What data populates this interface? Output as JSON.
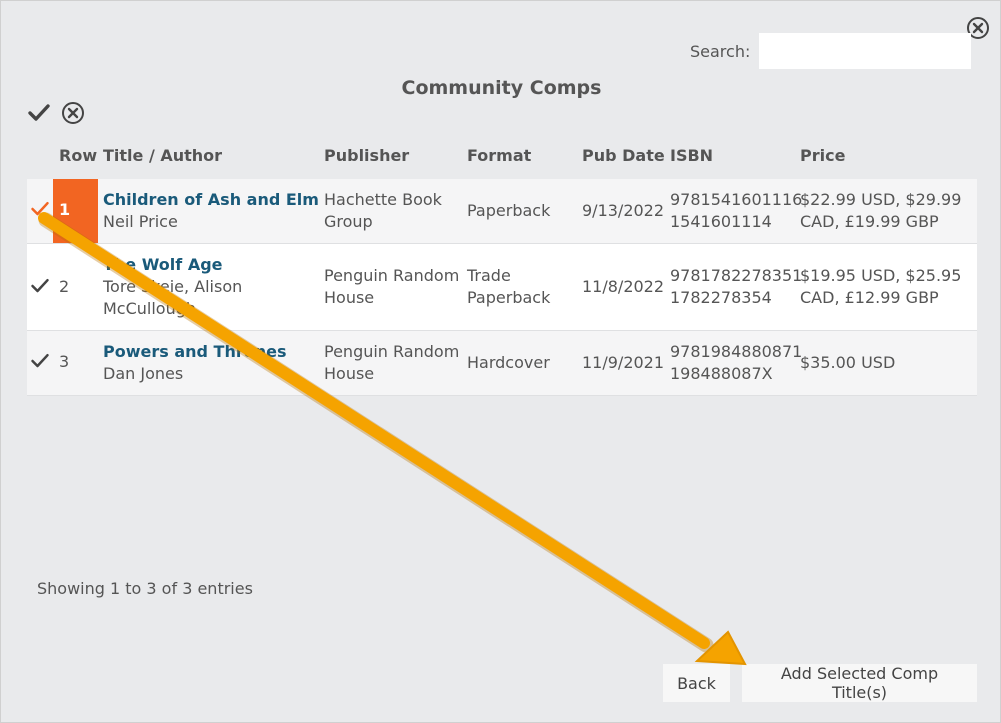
{
  "search": {
    "label": "Search:",
    "value": "",
    "placeholder": ""
  },
  "dialog": {
    "title": "Community Comps"
  },
  "columns": {
    "row": "Row",
    "title_author": "Title / Author",
    "publisher": "Publisher",
    "format": "Format",
    "pub_date": "Pub Date",
    "isbn": "ISBN",
    "price": "Price"
  },
  "rows": [
    {
      "num": "1",
      "title": "Children of Ash and Elm",
      "author": "Neil Price",
      "publisher_l1": "Hachette Book",
      "publisher_l2": "Group",
      "format_l1": "Paperback",
      "format_l2": "",
      "pub_date": "9/13/2022",
      "isbn13": "9781541601116",
      "isbn10": "1541601114",
      "price_l1": "$22.99 USD, $29.99",
      "price_l2": "CAD, £19.99 GBP",
      "selected": true
    },
    {
      "num": "2",
      "title": "The Wolf Age",
      "author_l1": "Tore Skeie, Alison",
      "author_l2": "McCullough",
      "publisher_l1": "Penguin Random",
      "publisher_l2": "House",
      "format_l1": "Trade",
      "format_l2": "Paperback",
      "pub_date": "11/8/2022",
      "isbn13": "9781782278351",
      "isbn10": "1782278354",
      "price_l1": "$19.95 USD, $25.95",
      "price_l2": "CAD, £12.99 GBP",
      "selected": false
    },
    {
      "num": "3",
      "title": "Powers and Thrones",
      "author": "Dan Jones",
      "publisher_l1": "Penguin Random",
      "publisher_l2": "House",
      "format_l1": "Hardcover",
      "pub_date": "11/9/2021",
      "isbn13": "9781984880871",
      "isbn10": "198488087X",
      "price_l1": "$35.00 USD",
      "selected": false
    }
  ],
  "info": "Showing 1 to 3 of 3 entries",
  "buttons": {
    "back": "Back",
    "add": "Add Selected Comp Title(s)"
  },
  "colors": {
    "selected_accent": "#f26522",
    "link": "#1a5a7a",
    "annotation_arrow": "#f5a300"
  },
  "icons": {
    "close": "close-circle-icon",
    "select_all": "checkmark-icon",
    "clear_all": "close-circle-icon",
    "row_check": "checkmark-icon"
  }
}
